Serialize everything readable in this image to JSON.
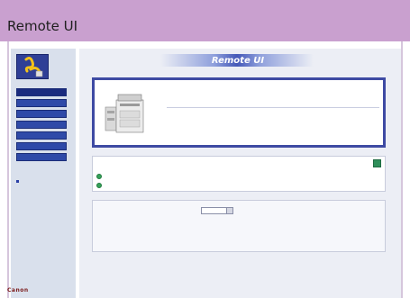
{
  "caption": "Remote UI",
  "banner_title": "Remote UI",
  "colors": {
    "caption_bar": "#c9a0cf",
    "nav_button": "#2f4aa8",
    "panel_border": "#3e4aa3",
    "status_ok": "#36a15a",
    "brand": "#7a1a1a"
  },
  "sidebar": {
    "logo_icon": "remote-ui-logo-icon",
    "nav_items": [
      "",
      "",
      "",
      "",
      "",
      "",
      "",
      ""
    ],
    "link_text": "",
    "brand": "Canon"
  },
  "device": {
    "name_lines": [
      "",
      "",
      ""
    ],
    "printer_name_label": "",
    "printer_name_value": "",
    "location_label": "",
    "location_value": "",
    "extra": ""
  },
  "status": {
    "header": "",
    "printer_label": "",
    "printer_value": "",
    "scanner_label": "",
    "scanner_value": "",
    "icons": {
      "refresh": "refresh-icon",
      "indicator": "status-ok-icon"
    }
  },
  "settings": {
    "language_label": "",
    "language_value": "",
    "system_manager_label": "",
    "support_label": ""
  }
}
